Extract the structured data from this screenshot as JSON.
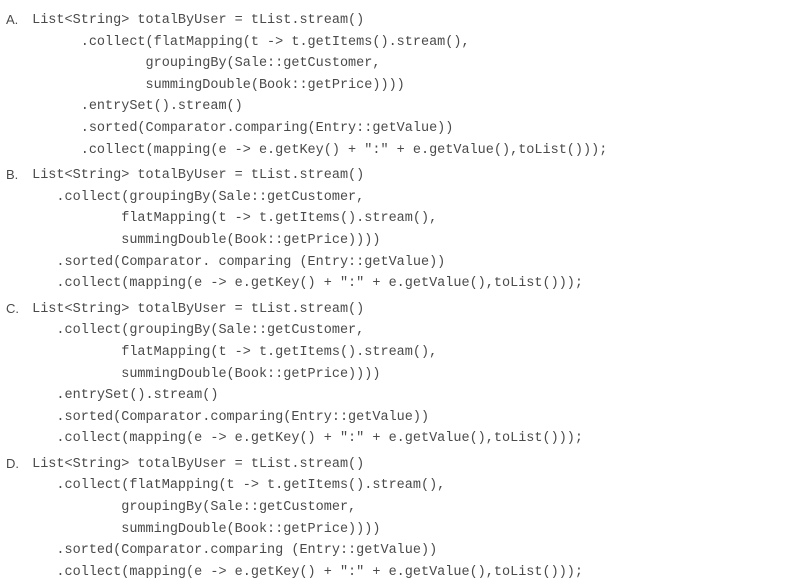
{
  "options": [
    {
      "label": "A.",
      "lines": [
        "List<String> totalByUser = tList.stream()",
        "      .collect(flatMapping(t -> t.getItems().stream(),",
        "              groupingBy(Sale::getCustomer,",
        "              summingDouble(Book::getPrice))))",
        "      .entrySet().stream()",
        "      .sorted(Comparator.comparing(Entry::getValue))",
        "      .collect(mapping(e -> e.getKey() + \":\" + e.getValue(),toList()));"
      ]
    },
    {
      "label": "B.",
      "lines": [
        "List<String> totalByUser = tList.stream()",
        "   .collect(groupingBy(Sale::getCustomer,",
        "           flatMapping(t -> t.getItems().stream(),",
        "           summingDouble(Book::getPrice))))",
        "   .sorted(Comparator. comparing (Entry::getValue))",
        "   .collect(mapping(e -> e.getKey() + \":\" + e.getValue(),toList()));"
      ]
    },
    {
      "label": "C.",
      "lines": [
        "List<String> totalByUser = tList.stream()",
        "   .collect(groupingBy(Sale::getCustomer,",
        "           flatMapping(t -> t.getItems().stream(),",
        "           summingDouble(Book::getPrice))))",
        "   .entrySet().stream()",
        "   .sorted(Comparator.comparing(Entry::getValue))",
        "   .collect(mapping(e -> e.getKey() + \":\" + e.getValue(),toList()));"
      ]
    },
    {
      "label": "D.",
      "lines": [
        "List<String> totalByUser = tList.stream()",
        "   .collect(flatMapping(t -> t.getItems().stream(),",
        "           groupingBy(Sale::getCustomer,",
        "           summingDouble(Book::getPrice))))",
        "   .sorted(Comparator.comparing (Entry::getValue))",
        "   .collect(mapping(e -> e.getKey() + \":\" + e.getValue(),toList()));"
      ]
    }
  ]
}
